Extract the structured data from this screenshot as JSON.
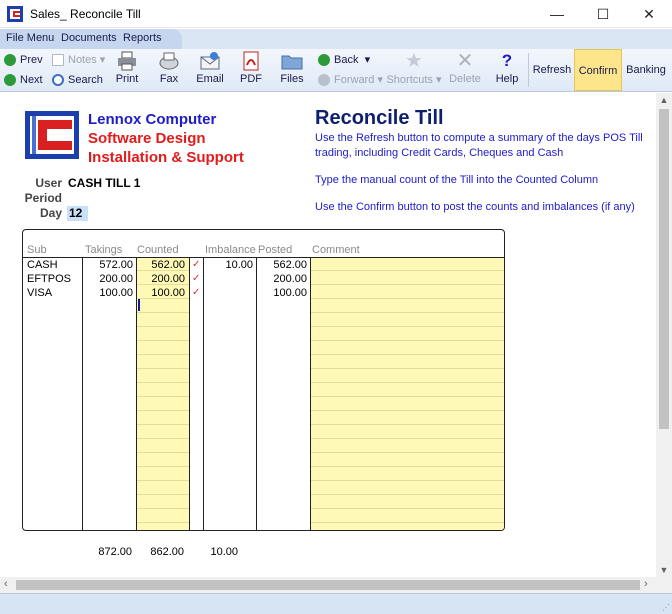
{
  "window": {
    "title": "Sales_ Reconcile Till",
    "minimize": "—",
    "maximize": "☐",
    "close": "✕"
  },
  "menu": {
    "items": [
      "File Menu",
      "Documents",
      "Reports"
    ]
  },
  "toolbar": {
    "prev": "Prev",
    "next": "Next",
    "notes": "Notes",
    "search": "Search",
    "print": "Print",
    "fax": "Fax",
    "email": "Email",
    "pdf": "PDF",
    "files": "Files",
    "back": "Back",
    "forward": "Forward",
    "shortcuts": "Shortcuts",
    "delete": "Delete",
    "help": "Help",
    "refresh": "Refresh",
    "confirm": "Confirm",
    "banking": "Banking"
  },
  "company": {
    "line1": "Lennox Computer",
    "line2": "Software Design",
    "line3": "Installation & Support",
    "color_blue": "#1c1cc9",
    "color_red": "#e31b1b"
  },
  "fields": {
    "user_label": "User",
    "user_value": "CASH TILL 1",
    "period_label": "Period",
    "day_label": "Day",
    "day_value": "12"
  },
  "page": {
    "title": "Reconcile Till",
    "instructions": [
      "Use the Refresh button to compute a summary of the days POS Till trading, including Credit Cards, Cheques and Cash",
      "Type the manual count of the Till into the Counted Column",
      "Use the Confirm button to post the counts and imbalances (if any)"
    ]
  },
  "grid": {
    "headers": {
      "sub": "Sub",
      "takings": "Takings",
      "counted": "Counted",
      "imbalance": "Imbalance",
      "posted": "Posted",
      "comment": "Comment"
    },
    "rows": [
      {
        "sub": "CASH",
        "takings": "572.00",
        "counted": "562.00",
        "tick": "✓",
        "imbalance": "10.00",
        "posted": "562.00",
        "comment": ""
      },
      {
        "sub": "EFTPOS",
        "takings": "200.00",
        "counted": "200.00",
        "tick": "✓",
        "imbalance": "",
        "posted": "200.00",
        "comment": ""
      },
      {
        "sub": "VISA",
        "takings": "100.00",
        "counted": "100.00",
        "tick": "✓",
        "imbalance": "",
        "posted": "100.00",
        "comment": ""
      }
    ]
  },
  "totals": {
    "takings": "872.00",
    "counted": "862.00",
    "imbalance": "10.00"
  }
}
